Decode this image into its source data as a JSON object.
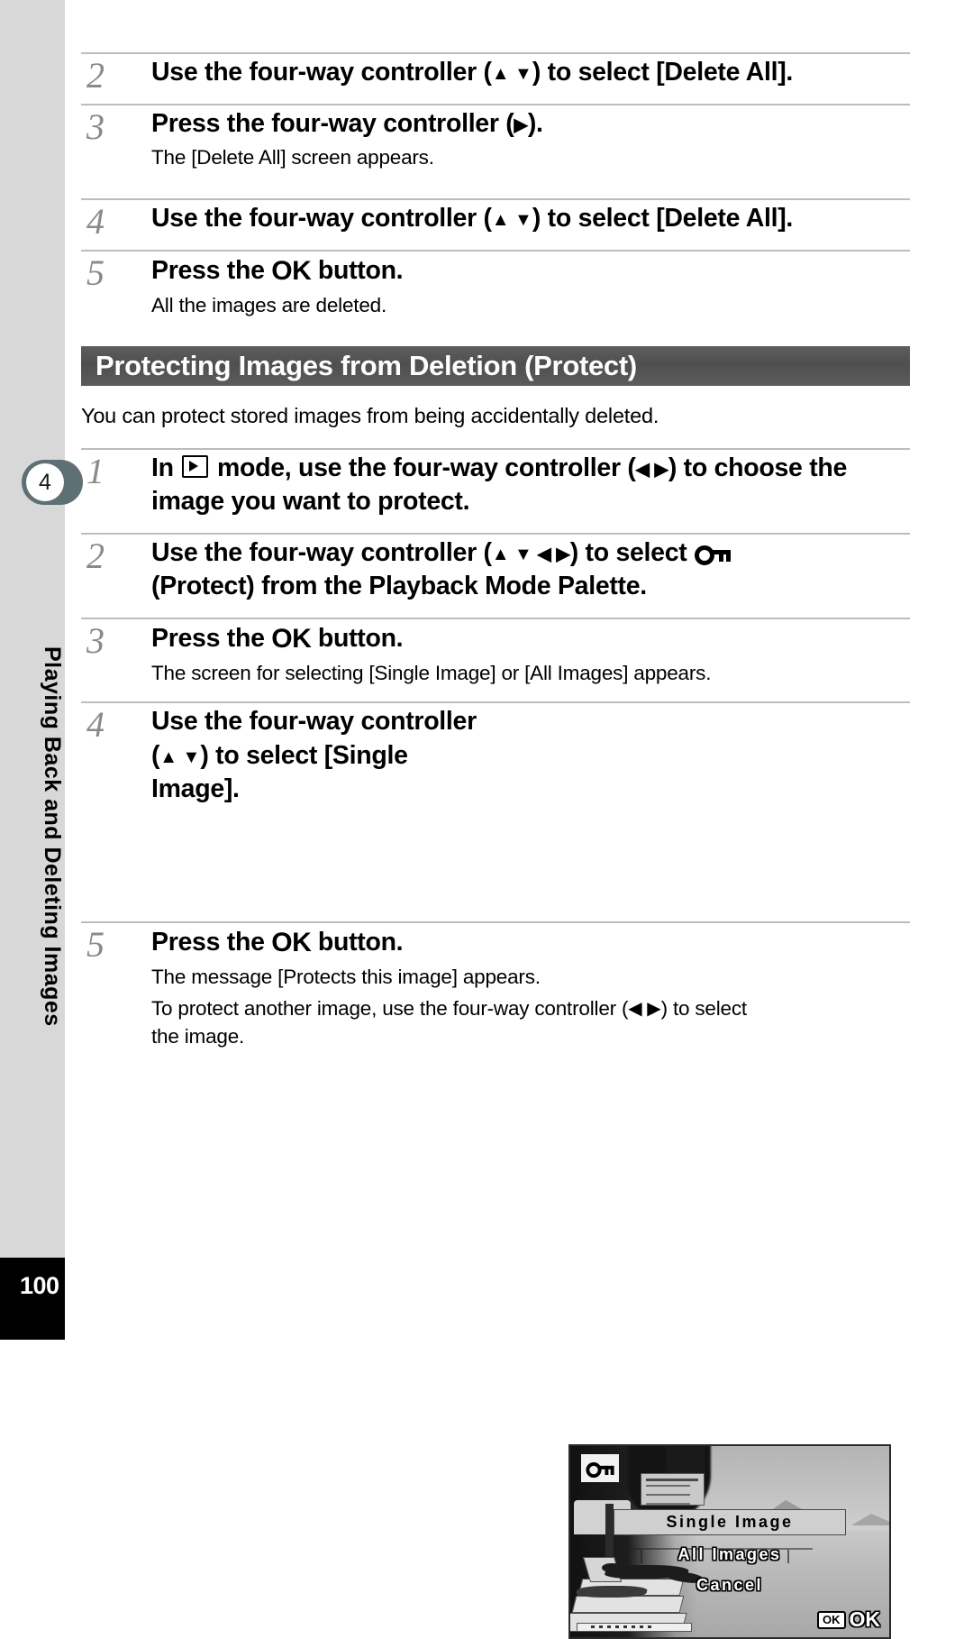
{
  "page": {
    "number": "100",
    "chapter_badge": "4",
    "chapter_title": "Playing Back and Deleting Images"
  },
  "top_steps": [
    {
      "number": "2",
      "title_pre": "Use the four-way controller (",
      "title_post": ") to select [Delete All].",
      "controls": "▲ ▼",
      "desc": ""
    },
    {
      "number": "3",
      "title_pre": "Press the four-way controller (",
      "title_post": ").",
      "controls": "▶",
      "desc": "The [Delete All] screen appears."
    },
    {
      "number": "4",
      "title_pre": "Use the four-way controller (",
      "title_post": ") to select [Delete All].",
      "controls": "▲ ▼",
      "desc": ""
    },
    {
      "number": "5",
      "title_pre": "Press the ",
      "ok_label": "OK",
      "title_post": " button.",
      "desc": "All the images are deleted."
    }
  ],
  "section": {
    "heading": "Protecting Images from Deletion (Protect)",
    "intro": "You can protect stored images from being accidentally deleted."
  },
  "protect_steps": [
    {
      "number": "1",
      "title_a": "In ",
      "icon": "playback-mode-icon",
      "title_b": " mode, use the four-way controller (",
      "controls": "◀ ▶",
      "title_c": ") to choose the image you want to protect.",
      "desc": ""
    },
    {
      "number": "2",
      "title_a": "Use the four-way controller (",
      "controls": "▲ ▼ ◀ ▶",
      "title_b": ") to select ",
      "icon": "key-protect-icon",
      "title_c": "(Protect) from the Playback Mode Palette.",
      "desc": ""
    },
    {
      "number": "3",
      "title_pre": "Press the ",
      "ok_label": "OK",
      "title_post": " button.",
      "desc": "The screen for selecting [Single Image] or [All Images] appears."
    },
    {
      "number": "4",
      "title_a": "Use the four-way controller",
      "title_b": "(",
      "controls": "▲ ▼",
      "title_c": ") to select [Single",
      "title_d": "Image].",
      "desc": ""
    },
    {
      "number": "5",
      "title_pre": "Press the ",
      "ok_label": "OK",
      "title_post": " button.",
      "desc1": "The message [Protects this image] appears.",
      "desc2_a": "To protect another image, use the four-way controller (",
      "controls2": "◀ ▶",
      "desc2_b": ") to select",
      "desc3": "the image."
    }
  ],
  "lcd": {
    "protect_badge_icon": "key-protect-icon",
    "menu": [
      {
        "label": "Single Image",
        "selected": true
      },
      {
        "label": "All Images",
        "selected": false
      },
      {
        "label": "Cancel",
        "selected": false
      }
    ],
    "ok_box_text": "OK",
    "ok_label": "OK"
  },
  "colors": {
    "sidebar_bg": "#d8d8d8",
    "badge_bg": "#5f7075",
    "section_bar": "#545454",
    "rule": "#bdbdbd",
    "step_number": "#8a8a8a"
  }
}
